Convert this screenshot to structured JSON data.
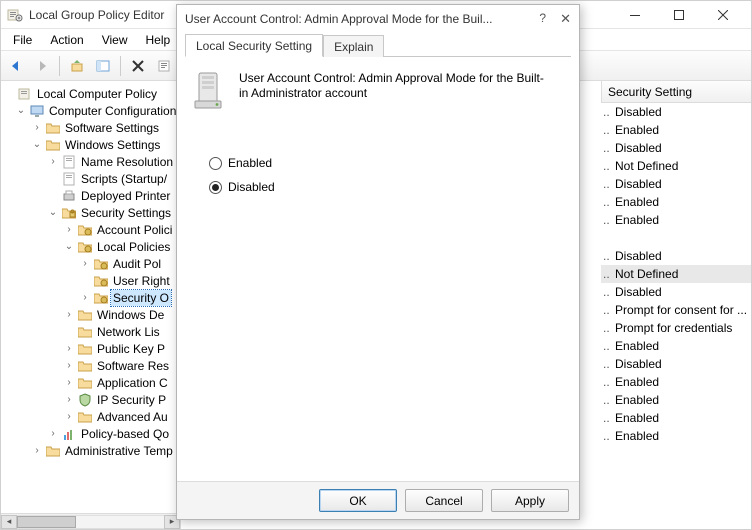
{
  "window": {
    "title": "Local Group Policy Editor",
    "menu": [
      "File",
      "Action",
      "View",
      "Help"
    ]
  },
  "tree": {
    "root": "Local Computer Policy",
    "comp_config": "Computer Configuration",
    "software": "Software Settings",
    "windows": "Windows Settings",
    "name_res": "Name Resolution",
    "scripts": "Scripts (Startup/",
    "deployed": "Deployed Printer",
    "security": "Security Settings",
    "account": "Account Polici",
    "local_pol": "Local Policies",
    "audit": "Audit Pol",
    "user_right": "User Right",
    "sec_opt": "Security O",
    "win_def": "Windows De",
    "net_list": "Network Lis",
    "pubkey": "Public Key P",
    "soft_res": "Software Res",
    "app_ctrl": "Application C",
    "ipsec": "IP Security P",
    "adv_au": "Advanced Au",
    "policy_qos": "Policy-based Qo",
    "admin_temp": "Administrative Temp"
  },
  "right": {
    "header": "Security Setting",
    "rows": [
      {
        "v": "Disabled"
      },
      {
        "v": "Enabled"
      },
      {
        "v": "Disabled"
      },
      {
        "v": "Not Defined"
      },
      {
        "v": "Disabled"
      },
      {
        "v": "Enabled"
      },
      {
        "v": "Enabled"
      },
      {
        "spacer": true
      },
      {
        "v": "Disabled"
      },
      {
        "v": "Not Defined",
        "hl": true
      },
      {
        "v": "Disabled"
      },
      {
        "v": "Prompt for consent for ..."
      },
      {
        "v": "Prompt for credentials"
      },
      {
        "v": "Enabled"
      },
      {
        "v": "Disabled"
      },
      {
        "v": "Enabled"
      },
      {
        "v": "Enabled"
      },
      {
        "v": "Enabled"
      },
      {
        "v": "Enabled"
      }
    ]
  },
  "dialog": {
    "title": "User Account Control: Admin Approval Mode for the Buil...",
    "tabs": [
      "Local Security Setting",
      "Explain"
    ],
    "policy_name": "User Account Control: Admin Approval Mode for the Built-in Administrator account",
    "opt_enabled": "Enabled",
    "opt_disabled": "Disabled",
    "selected": "Disabled",
    "btn_ok": "OK",
    "btn_cancel": "Cancel",
    "btn_apply": "Apply"
  }
}
